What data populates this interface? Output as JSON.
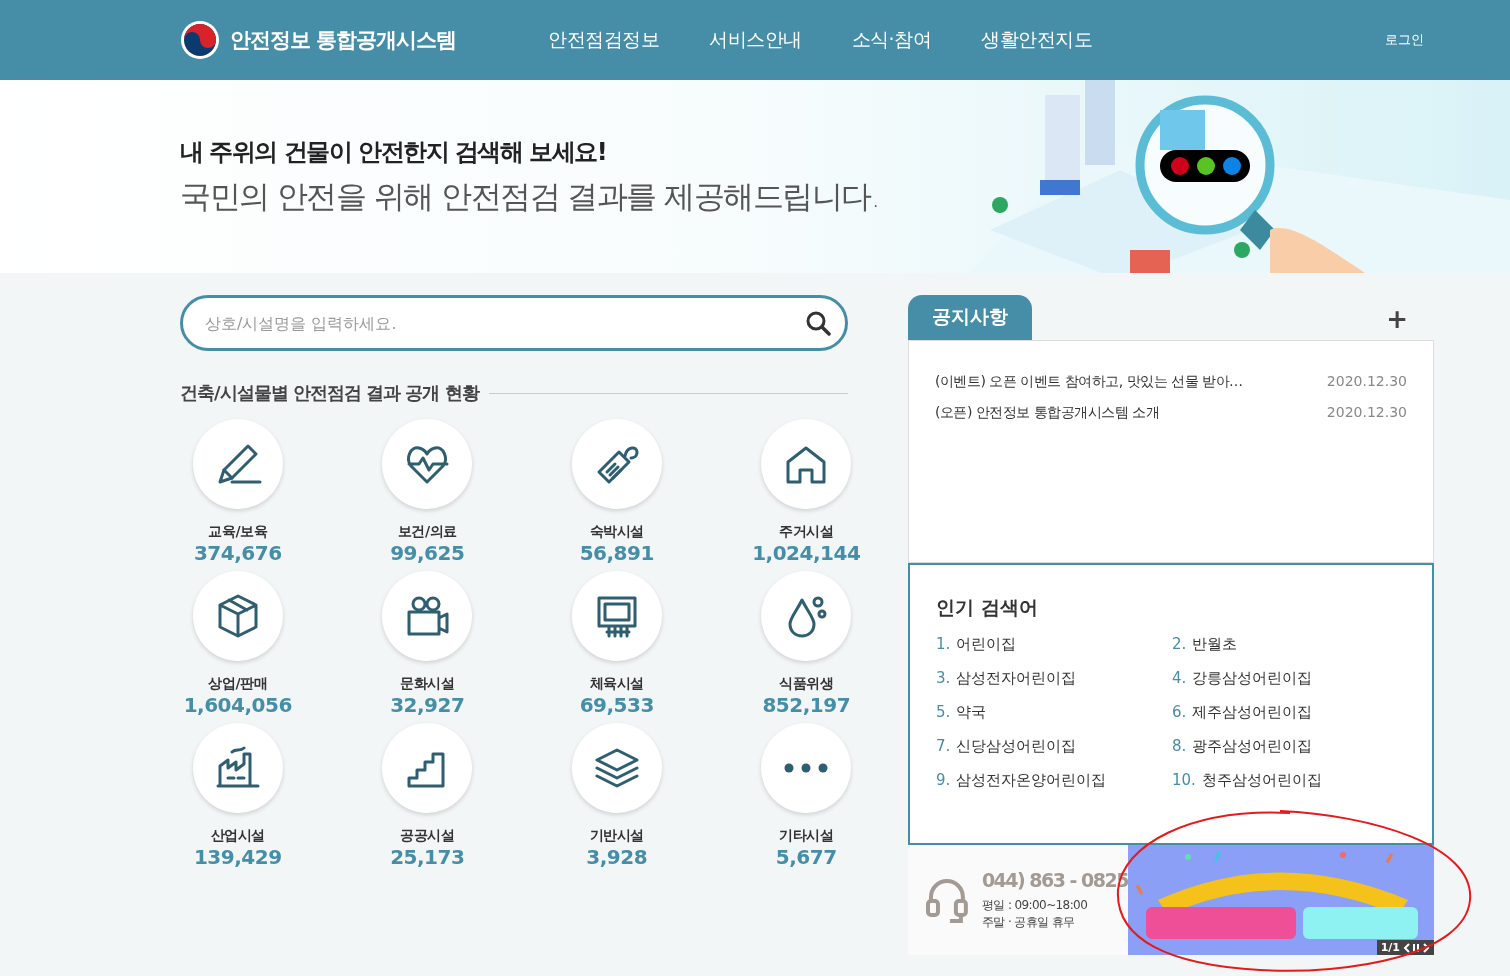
{
  "header": {
    "site_title": "안전정보 통합공개시스템",
    "nav": [
      {
        "label": "안전점검정보"
      },
      {
        "label": "서비스안내"
      },
      {
        "label": "소식·참여"
      },
      {
        "label": "생활안전지도"
      }
    ],
    "login": "로그인"
  },
  "hero": {
    "headline": "내 주위의 건물이 안전한지 검색해 보세요!",
    "subline": "국민의 안전을 위해 안전점검 결과를 제공해드립니다.",
    "kind": "picture"
  },
  "search": {
    "placeholder": "상호/시설명을 입력하세요."
  },
  "categories_title": "건축/시설물별 안전점검 결과 공개 현황",
  "categories": [
    {
      "kind": "pencil",
      "label": "교육/보육",
      "count": "374,676"
    },
    {
      "kind": "heart",
      "label": "보건/의료",
      "count": "99,625"
    },
    {
      "kind": "tag",
      "label": "숙박시설",
      "count": "56,891"
    },
    {
      "kind": "house",
      "label": "주거시설",
      "count": "1,024,144"
    },
    {
      "kind": "box",
      "label": "상업/판매",
      "count": "1,604,056"
    },
    {
      "kind": "camera",
      "label": "문화시설",
      "count": "32,927"
    },
    {
      "kind": "goal",
      "label": "체육시설",
      "count": "69,533"
    },
    {
      "kind": "drop",
      "label": "식품위생",
      "count": "852,197"
    },
    {
      "kind": "factory",
      "label": "산업시설",
      "count": "139,429"
    },
    {
      "kind": "stairs",
      "label": "공공시설",
      "count": "25,173"
    },
    {
      "kind": "layers",
      "label": "기반시설",
      "count": "3,928"
    },
    {
      "kind": "dots",
      "label": "기타시설",
      "count": "5,677"
    }
  ],
  "notice": {
    "tab": "공지사항",
    "more": "+",
    "items": [
      {
        "title": "(이벤트) 오픈 이벤트 참여하고, 맛있는 선물 받아…",
        "date": "2020.12.30"
      },
      {
        "title": "(오픈) 안전정보 통합공개시스템 소개",
        "date": "2020.12.30"
      }
    ]
  },
  "popular": {
    "title": "인기 검색어",
    "items": [
      {
        "rank": "1.",
        "term": "어린이집"
      },
      {
        "rank": "2.",
        "term": "반월초"
      },
      {
        "rank": "3.",
        "term": "삼성전자어린이집"
      },
      {
        "rank": "4.",
        "term": "강릉삼성어린이집"
      },
      {
        "rank": "5.",
        "term": "약국"
      },
      {
        "rank": "6.",
        "term": "제주삼성어린이집"
      },
      {
        "rank": "7.",
        "term": "신당삼성어린이집"
      },
      {
        "rank": "8.",
        "term": "광주삼성어린이집"
      },
      {
        "rank": "9.",
        "term": "삼성전자온양어린이집"
      },
      {
        "rank": "10.",
        "term": "청주삼성어린이집"
      }
    ]
  },
  "contact": {
    "phone": "044) 863 - 0825",
    "hours": "평일 : 09:00~18:00",
    "closed": "주말 · 공휴일 휴무"
  },
  "banner": {
    "kind": "picture",
    "counter": "1/1"
  }
}
